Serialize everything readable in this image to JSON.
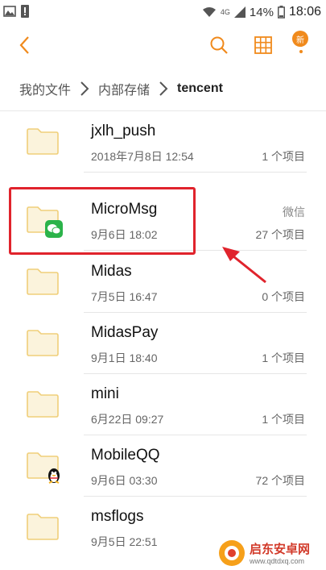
{
  "status_bar": {
    "signal_label": "4G",
    "battery": "14%",
    "time": "18:06"
  },
  "toolbar": {
    "badge": "新"
  },
  "breadcrumb": [
    "我的文件",
    "内部存储",
    "tencent"
  ],
  "colors": {
    "accent": "#f08a1c",
    "folder": "#f5d98b",
    "highlight": "#e0232c"
  },
  "files": [
    {
      "name": "jxlh_push",
      "date": "2018年7月8日 12:54",
      "count": "1 个项目",
      "tag": ""
    },
    {
      "name": "MicroMsg",
      "date": "9月6日 18:02",
      "count": "27 个项目",
      "tag": "微信",
      "overlay": "wechat-icon"
    },
    {
      "name": "Midas",
      "date": "7月5日 16:47",
      "count": "0 个项目",
      "tag": ""
    },
    {
      "name": "MidasPay",
      "date": "9月1日 18:40",
      "count": "1 个项目",
      "tag": ""
    },
    {
      "name": "mini",
      "date": "6月22日 09:27",
      "count": "1 个项目",
      "tag": ""
    },
    {
      "name": "MobileQQ",
      "date": "9月6日 03:30",
      "count": "72 个项目",
      "tag": "",
      "overlay": "qq-penguin-icon"
    },
    {
      "name": "msflogs",
      "date": "9月5日 22:51",
      "count": "",
      "tag": ""
    }
  ],
  "watermark": {
    "title": "启东安卓网",
    "url": "www.qdtdxq.com"
  }
}
